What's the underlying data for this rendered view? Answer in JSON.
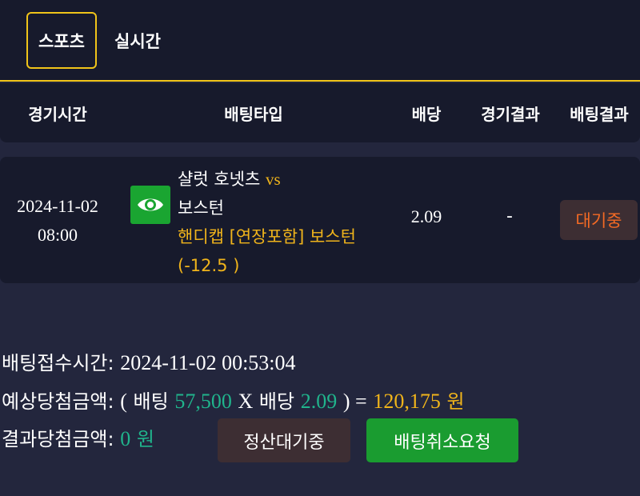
{
  "tabs": {
    "sports": "스포츠",
    "live": "실시간"
  },
  "table_header": {
    "game_time": "경기시간",
    "bet_type": "배팅타입",
    "odds": "배당",
    "game_result": "경기결과",
    "bet_result": "배팅결과"
  },
  "bet": {
    "date": "2024-11-02",
    "time": "08:00",
    "icon": "eye-icon",
    "home_team": "샬럿 호넷츠",
    "vs": "vs",
    "away_team": "보스턴",
    "pick": "핸디캡 [연장포함] 보스턴",
    "handicap": "(-12.5 )",
    "odds": "2.09",
    "game_result": "-",
    "status": "대기중"
  },
  "summary": {
    "received_label": "배팅접수시간:",
    "received_value": "2024-11-02 00:53:04",
    "expected_label": "예상당첨금액:",
    "open_paren": "(",
    "stake_label": "배팅",
    "stake_value": "57,500",
    "times": "X",
    "odds_label": "배당",
    "odds_value": "2.09",
    "close_eq": ") =",
    "payout_value": "120,175",
    "won": "원",
    "result_label": "결과당첨금액:",
    "result_value": "0",
    "result_won": "원"
  },
  "buttons": {
    "pending": "정산대기중",
    "cancel": "배팅취소요청"
  },
  "colors": {
    "accent": "#f0c419",
    "highlight": "#f0b41b",
    "teal": "#20b48c",
    "pending": "#f46a24",
    "green_button": "#1a9c30",
    "background": "#23263d",
    "panel": "#171a2c"
  }
}
